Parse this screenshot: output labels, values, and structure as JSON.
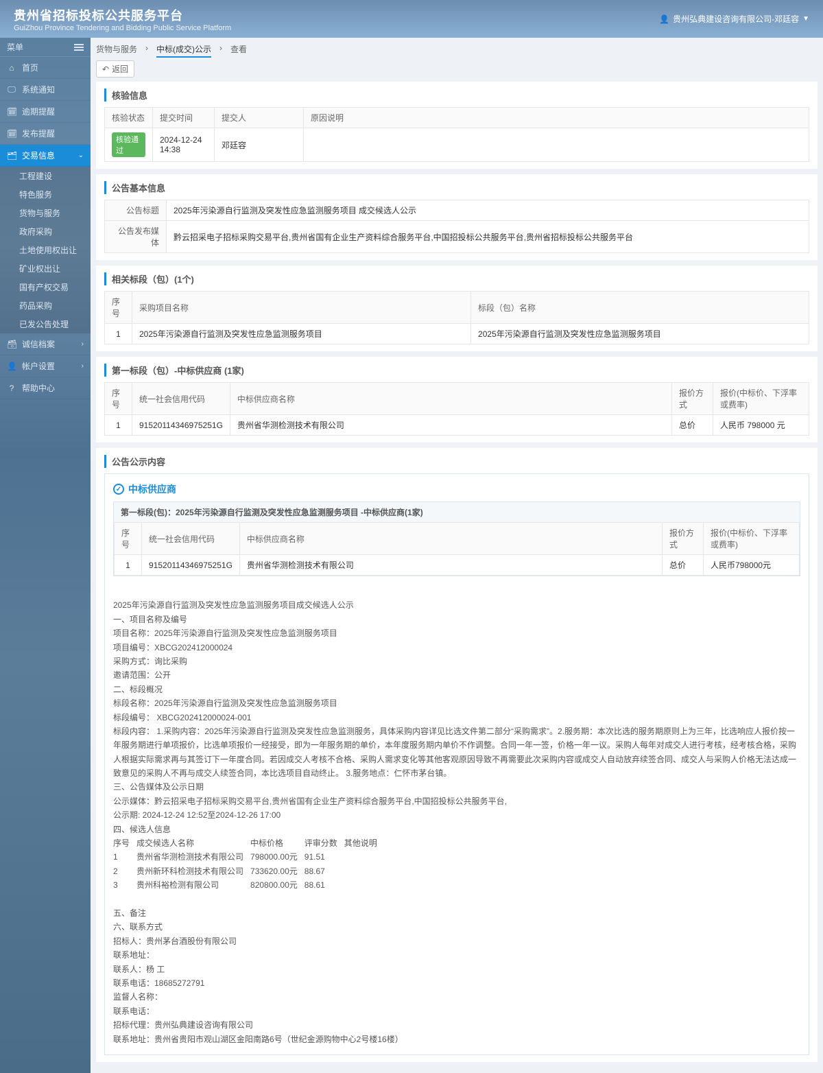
{
  "header": {
    "title": "贵州省招标投标公共服务平台",
    "subtitle": "GuiZhou Province Tendering and Bidding Public Service Platform",
    "user": "贵州弘典建设咨询有限公司-邓廷容"
  },
  "sidebar": {
    "menu_label": "菜单",
    "items": {
      "home": "首页",
      "notice": "系统通知",
      "overdue": "逾期提醒",
      "publish": "发布提醒",
      "trade": "交易信息",
      "integrity": "诚信档案",
      "account": "帐户设置",
      "help": "帮助中心"
    },
    "trade_sub": {
      "s0": "工程建设",
      "s1": "特色服务",
      "s2": "货物与服务",
      "s3": "政府采购",
      "s4": "土地使用权出让",
      "s5": "矿业权出让",
      "s6": "国有产权交易",
      "s7": "药品采购",
      "s8": "已发公告处理"
    }
  },
  "breadcrumb": {
    "b0": "货物与服务",
    "b1": "中标(成交)公示",
    "b2": "查看"
  },
  "back_label": "返回",
  "verify": {
    "title": "核验信息",
    "h_status": "核验状态",
    "h_time": "提交时间",
    "h_person": "提交人",
    "h_reason": "原因说明",
    "status": "核验通过",
    "time": "2024-12-24 14:38",
    "person": "邓廷容"
  },
  "basic": {
    "title": "公告基本信息",
    "l_title": "公告标题",
    "v_title": "2025年污染源自行监测及突发性应急监测服务项目 成交候选人公示",
    "l_media": "公告发布媒体",
    "v_media": "黔云招采电子招标采购交易平台,贵州省国有企业生产资料综合服务平台,中国招投标公共服务平台,贵州省招标投标公共服务平台"
  },
  "related": {
    "title": "相关标段（包）(1个)",
    "h_no": "序号",
    "h_proj": "采购项目名称",
    "h_sec": "标段（包）名称",
    "r0": {
      "no": "1",
      "proj": "2025年污染源自行监测及突发性应急监测服务项目",
      "sec": "2025年污染源自行监测及突发性应急监测服务项目"
    }
  },
  "winner": {
    "title": "第一标段（包）-中标供应商 (1家)",
    "h_no": "序号",
    "h_code": "统一社会信用代码",
    "h_name": "中标供应商名称",
    "h_method": "报价方式",
    "h_price": "报价(中标价、下浮率或费率)",
    "r0": {
      "no": "1",
      "code": "91520114346975251G",
      "name": "贵州省华测检测技术有限公司",
      "method": "总价",
      "price": "人民币 798000 元"
    }
  },
  "content": {
    "title": "公告公示内容",
    "supplier_heading": "中标供应商",
    "sub_title": "第一标段(包)：2025年污染源自行监测及突发性应急监测服务项目 -中标供应商(1家)",
    "tbl": {
      "h_no": "序号",
      "h_code": "统一社会信用代码",
      "h_name": "中标供应商名称",
      "h_method": "报价方式",
      "h_price": "报价(中标价、下浮率或费率)",
      "no": "1",
      "code": "91520114346975251G",
      "name": "贵州省华测检测技术有限公司",
      "method": "总价",
      "price": "人民币798000元"
    },
    "body_head": "2025年污染源自行监测及突发性应急监测服务项目成交候选人公示",
    "sec1_h": "一、项目名称及编号",
    "sec1_1": "项目名称：2025年污染源自行监测及突发性应急监测服务项目",
    "sec1_2": "项目编号：XBCG202412000024",
    "sec1_3": "采购方式：询比采购",
    "sec1_4": "邀请范围：公开",
    "sec2_h": "二、标段概况",
    "sec2_1": "标段名称：2025年污染源自行监测及突发性应急监测服务项目",
    "sec2_2": "标段编号： XBCG202412000024-001",
    "sec2_3": "标段内容： 1.采购内容：2025年污染源自行监测及突发性应急监测服务，具体采购内容详见比选文件第二部分“采购需求”。2.服务期：本次比选的服务期原则上为三年，比选响应人报价按一年服务期进行单项报价，比选单项报价一经接受，即为一年服务期的单价，本年度服务期内单价不作调整。合同一年一签，价格一年一议。采购人每年对成交人进行考核，经考核合格，采购人根据实际需求再与其签订下一年度合同。若因成交人考核不合格、采购人需求变化等其他客观原因导致不再需要此次采购内容或成交人自动放弃续签合同、成交人与采购人价格无法达成一致意见的采购人不再与成交人续签合同，本比选项目自动终止。 3.服务地点：仁怀市茅台镇。",
    "sec3_h": "三、公告媒体及公示日期",
    "sec3_1": "公示媒体：黔云招采电子招标采购交易平台,贵州省国有企业生产资料综合服务平台,中国招投标公共服务平台,",
    "sec3_2": "公示期: 2024-12-24 12:52至2024-12-26 17:00",
    "sec4_h": "四、候选人信息",
    "cand_h": {
      "no": "序号",
      "name": "成交候选人名称",
      "price": "中标价格",
      "score": "评审分数",
      "other": "其他说明"
    },
    "cand": [
      {
        "no": "1",
        "name": "贵州省华测检测技术有限公司",
        "price": "798000.00元",
        "score": "91.51"
      },
      {
        "no": "2",
        "name": "贵州新环科检测技术有限公司",
        "price": "733620.00元",
        "score": "88.67"
      },
      {
        "no": "3",
        "name": "贵州科裕检测有限公司",
        "price": "820800.00元",
        "score": "88.61"
      }
    ],
    "sec5_h": "五、备注",
    "sec6_h": "六、联系方式",
    "sec6_1": "招标人：贵州茅台酒股份有限公司",
    "sec6_2": "联系地址：",
    "sec6_3": "联系人：杨 工",
    "sec6_4": "联系电话：18685272791",
    "sec6_5": "监督人名称：",
    "sec6_6": "联系电话：",
    "sec6_7": "招标代理：贵州弘典建设咨询有限公司",
    "sec6_8": "联系地址：贵州省贵阳市观山湖区金阳南路6号（世纪金源购物中心2号楼16楼）"
  }
}
